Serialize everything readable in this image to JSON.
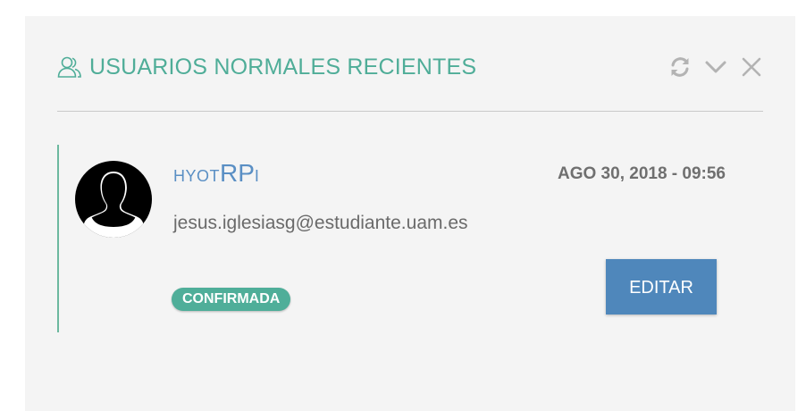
{
  "panel": {
    "title": "USUARIOS NORMALES RECIENTES",
    "icons": [
      "users-icon",
      "refresh-icon",
      "chevron-down-icon",
      "close-icon"
    ]
  },
  "user": {
    "username_part1": "hyot",
    "username_part2": "RP",
    "username_part3": "i",
    "timestamp": "AGO 30, 2018 - 09:56",
    "email": "jesus.iglesiasg@estudiante.uam.es",
    "status": "CONFIRMADA",
    "edit_label": "EDITAR"
  },
  "colors": {
    "accent": "#4fad98",
    "link": "#5a8fc4",
    "button": "#4f87bb",
    "panel_bg": "#f4f4f4"
  }
}
